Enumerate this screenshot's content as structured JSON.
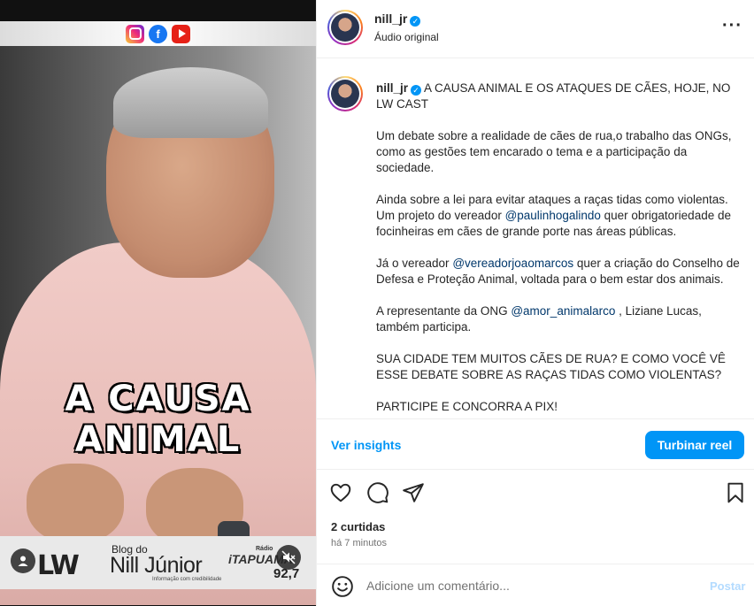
{
  "video": {
    "social_icons": [
      "instagram-icon",
      "facebook-icon",
      "youtube-icon"
    ],
    "caption": "A CAUSA ANIMAL",
    "lower_bar": {
      "logo": "LW",
      "blog_do": "Blog do",
      "blog_name": "Nill Júnior",
      "blog_sub": "Informação com credibilidade",
      "radio_label": "Rádio",
      "radio_name": "iTAPUAMA",
      "radio_freq": "92,7"
    }
  },
  "header": {
    "username": "nill_jr",
    "verified": true,
    "audio": "Áudio original",
    "more": "···"
  },
  "post": {
    "username": "nill_jr",
    "headline": "A CAUSA ANIMAL E OS ATAQUES DE CÃES, HOJE, NO LW CAST",
    "p1": "Um debate sobre a realidade de cães de rua,o trabalho das ONGs, como as gestões tem encarado o tema e a participação da sociedade.",
    "p2_a": "Ainda sobre a lei para evitar ataques a raças tidas como violentas. Um projeto do vereador ",
    "p2_mention": "@paulinhogalindo",
    "p2_b": " quer obrigatoriedade de focinheiras em cães de grande porte nas áreas públicas.",
    "p3_a": "Já o vereador ",
    "p3_mention": "@vereadorjoaomarcos",
    "p3_b": " quer a criação do Conselho de Defesa e Proteção Animal, voltada para o bem estar dos animais.",
    "p4_a": "A representante da ONG ",
    "p4_mention": "@amor_animalarco",
    "p4_b": " , Liziane Lucas, também participa.",
    "p5": "SUA CIDADE TEM MUITOS CÃES DE RUA? E COMO VOCÊ VÊ ESSE DEBATE SOBRE AS RAÇAS TIDAS COMO VIOLENTAS?",
    "p6": "PARTICIPE E CONCORRA A PIX!"
  },
  "insights": {
    "link": "Ver insights",
    "boost": "Turbinar reel"
  },
  "actions": {
    "icons": [
      "heart-icon",
      "comment-icon",
      "share-icon",
      "save-icon"
    ],
    "likes": "2 curtidas",
    "time": "há 7 minutos"
  },
  "comment": {
    "placeholder": "Adicione um comentário...",
    "post": "Postar"
  },
  "colors": {
    "accent": "#0095f6",
    "mention": "#00376b",
    "muted": "#737373",
    "post_disabled": "#b3dbff"
  }
}
